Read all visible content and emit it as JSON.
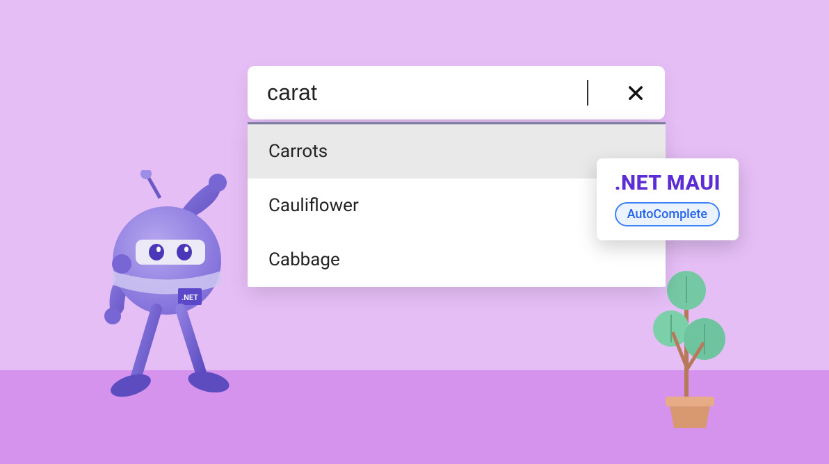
{
  "search": {
    "query": "carat",
    "clear_label": "Clear"
  },
  "suggestions": [
    {
      "label": "Carrots",
      "highlighted": true
    },
    {
      "label": "Cauliflower",
      "highlighted": false
    },
    {
      "label": "Cabbage",
      "highlighted": false
    }
  ],
  "badge": {
    "title": ".NET MAUI",
    "pill": "AutoComplete"
  },
  "colors": {
    "background": "#e5bef6",
    "ground": "#d593ed",
    "accent": "#5c2dd4",
    "pill_border": "#3b82f6"
  }
}
